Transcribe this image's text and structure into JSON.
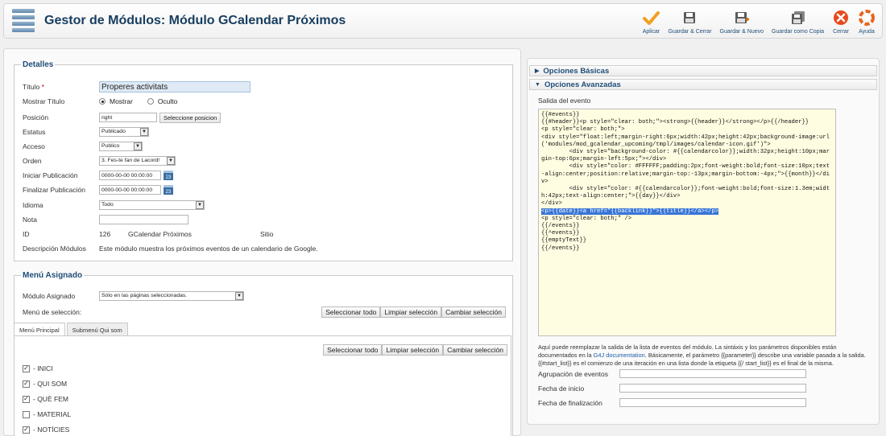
{
  "header": {
    "title": "Gestor de Módulos: Módulo GCalendar Próximos",
    "toolbar": [
      {
        "label": "Aplicar",
        "icon": "checkmark-icon"
      },
      {
        "label": "Guardar & Cerrar",
        "icon": "save-icon"
      },
      {
        "label": "Guardar & Nuevo",
        "icon": "save-new-icon"
      },
      {
        "label": "Guardar como Copia",
        "icon": "save-copy-icon"
      },
      {
        "label": "Cerrar",
        "icon": "close-icon"
      },
      {
        "label": "Ayuda",
        "icon": "help-icon"
      }
    ]
  },
  "details": {
    "legend": "Detalles",
    "title_label": "Título",
    "title_required": "*",
    "title_value": "Properes activitats",
    "show_title_label": "Mostrar Título",
    "show_option": "Mostrar",
    "hide_option": "Oculto",
    "position_label": "Posición",
    "position_value": "right",
    "position_button": "Seleccione posicion",
    "status_label": "Estatus",
    "status_value": "Publicado",
    "access_label": "Acceso",
    "access_value": "Publico",
    "order_label": "Orden",
    "order_value": "3. Fes-te fan de Lacord!",
    "start_pub_label": "Iniciar Publicación",
    "start_pub_value": "0000-00-00 00:00:00",
    "end_pub_label": "Finalizar Publicación",
    "end_pub_value": "0000-00-00 00:00:00",
    "language_label": "Idioma",
    "language_value": "Todo",
    "note_label": "Nota",
    "note_value": "",
    "id_label": "ID",
    "id_value": "126",
    "module_name": "GCalendar Próximos",
    "site_label": "Sitio",
    "desc_label": "Descripción Módulos",
    "desc_value": "Este módulo muestra los próximos eventos de un calendario de Google.",
    "calendar_glyph": "23"
  },
  "menu": {
    "legend": "Menú Asignado",
    "assigned_label": "Módulo Asignado",
    "assigned_value": "Sólo en las páginas seleccionadas.",
    "selection_label": "Menú de selección:",
    "select_all": "Seleccionar todo",
    "clear_selection": "Limpiar selección",
    "change_selection": "Cambiar selección",
    "tabs": [
      "Menú Principal",
      "Submenú Qui som"
    ],
    "items": [
      {
        "label": "- INICI",
        "checked": true,
        "mark": "✓"
      },
      {
        "label": "- QUI SOM",
        "checked": true,
        "mark": "✓"
      },
      {
        "label": "- QUÈ FEM",
        "checked": true,
        "mark": "✓"
      },
      {
        "label": "- MATERIAL",
        "checked": false,
        "mark": ""
      },
      {
        "label": "- NOTÍCIES",
        "checked": true,
        "mark": "✓"
      }
    ]
  },
  "options": {
    "basic_label": "Opciones Básicas",
    "advanced_label": "Opciones Avanzadas",
    "output_label": "Salida del evento",
    "code_before": "{{#events}}\n{{#header}}<p style=\"clear: both;\"><strong>{{header}}</strong></p>{{/header}}\n<p style=\"clear: both;\">\n<div style=\"float:left;margin-right:6px;width:42px;height:42px;background-image:url('modules/mod_gcalendar_upcoming/tmpl/images/calendar-icon.gif')\">\n        <div style=\"background-color: #{{calendarcolor}};width:32px;height:10px;margin-top:6px;margin-left:5px;\"></div>\n        <div style=\"color: #FFFFFF;padding:2px;font-weight:bold;font-size:10px;text-align:center;position:relative;margin-top:-13px;margin-bottom:-4px;\">{{month}}</div>\n        <div style=\"color: #{{calendarcolor}};font-weight:bold;font-size:1.3em;width:42px;text-align:center;\">{{day}}</div>\n</div>\n",
    "code_highlight": "<p>{{date}}<a href=\"{{backlink}}\">{{title}}</a></p>",
    "code_after": "\n<p style=\"clear: both;\" />\n{{/events}}\n{{^events}}\n{{emptyText}}\n{{/events}}",
    "help_part1": "Aquí puede reemplazar la salida de la lista de eventos del módulo. La sintáxis y los parámetros disponibles están documentados en la ",
    "help_link": "G4J documentation",
    "help_part2": ". Básicamente, el parámetro {{parameter}} describe una variable pasada a la salida. {{#start_list}} es el comienzo de una iteración en una lista donde la etiqueta {{/ start_list}} es el final de la misma.",
    "group_label": "Agrupación de eventos",
    "start_date_label": "Fecha de inicio",
    "end_date_label": "Fecha de finalización",
    "collapsed_glyph": "▶",
    "expanded_glyph": "▼"
  }
}
